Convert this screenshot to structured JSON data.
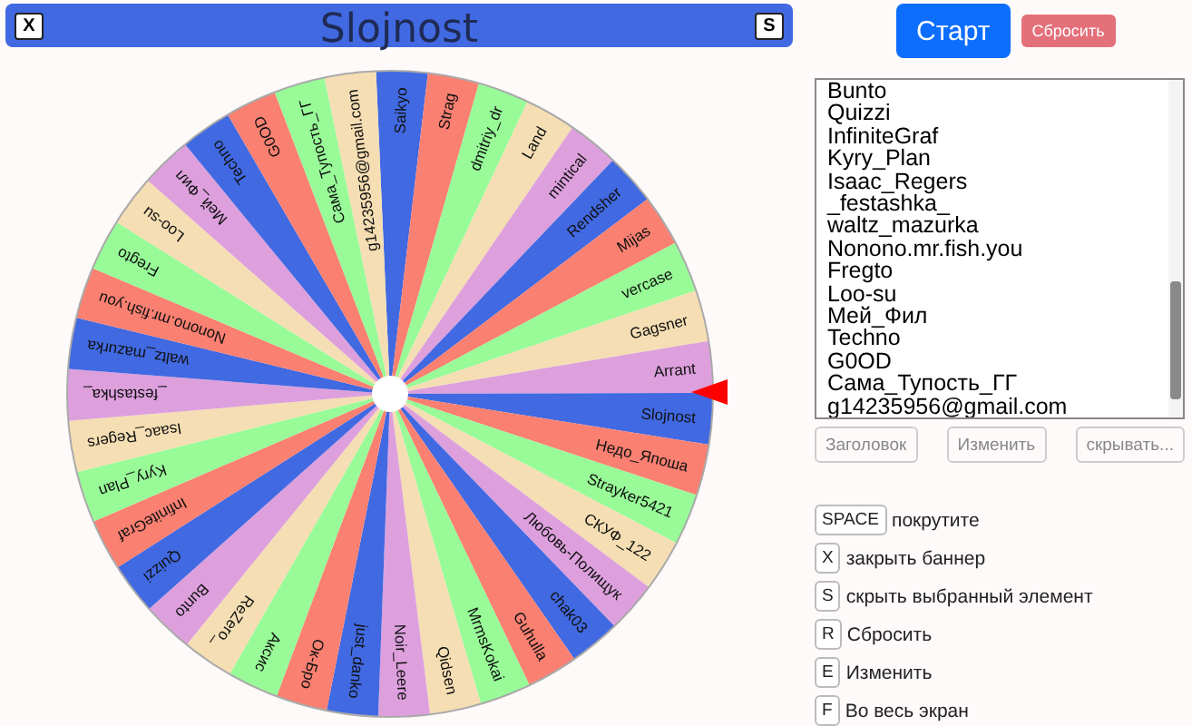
{
  "banner": {
    "title": "Slojnost",
    "close_key": "X",
    "hide_key": "S"
  },
  "wheel": {
    "segments": [
      {
        "label": "Saikyo"
      },
      {
        "label": "Strag"
      },
      {
        "label": "dmitriy_dr"
      },
      {
        "label": "Land"
      },
      {
        "label": "mintical"
      },
      {
        "label": "Rendsher"
      },
      {
        "label": "Mijas"
      },
      {
        "label": "vercase"
      },
      {
        "label": "Gagsner"
      },
      {
        "label": "Arrant"
      },
      {
        "label": "Slojnost"
      },
      {
        "label": "Недо_Япоша"
      },
      {
        "label": "Strayker5421"
      },
      {
        "label": "СКУФ_122"
      },
      {
        "label": "Любовь-Полищук"
      },
      {
        "label": "chak03"
      },
      {
        "label": "Guhulla"
      },
      {
        "label": "MrmsKokai"
      },
      {
        "label": "Qidsen"
      },
      {
        "label": "Noir_Leere"
      },
      {
        "label": "just_danko"
      },
      {
        "label": "Ок-Бро"
      },
      {
        "label": "Аксис"
      },
      {
        "label": "ReZero_"
      },
      {
        "label": "Bunto"
      },
      {
        "label": "Quizzi"
      },
      {
        "label": "InfiniteGraf"
      },
      {
        "label": "Kyry_Plan"
      },
      {
        "label": "Isaac_Regers"
      },
      {
        "label": "_festashka_"
      },
      {
        "label": "waltz_mazurka"
      },
      {
        "label": "Nonono.mr.fish.you"
      },
      {
        "label": "Fregto"
      },
      {
        "label": "Loo-su"
      },
      {
        "label": "Мей_Фил"
      },
      {
        "label": "Techno"
      },
      {
        "label": "G0OD"
      },
      {
        "label": "Сама_Тупость_ГГ"
      },
      {
        "label": "g14235956@gmail.com"
      }
    ]
  },
  "controls": {
    "start": "Старт",
    "reset": "Сбросить"
  },
  "entries": {
    "lines": [
      "Bunto",
      "Quizzi",
      "InfiniteGraf",
      "Kyry_Plan",
      "Isaac_Regers",
      "_festashka_",
      "waltz_mazurka",
      "Nonono.mr.fish.you",
      "Fregto",
      "Loo-su",
      "Мей_Фил",
      "Techno",
      "G0OD",
      "Сама_Тупость_ГГ",
      "g14235956@gmail.com"
    ]
  },
  "entry_buttons": [
    "Заголовок",
    "Изменить",
    "скрывать..."
  ],
  "shortcuts": [
    {
      "key": "SPACE",
      "action": "покрутите"
    },
    {
      "key": "X",
      "action": "закрыть баннер"
    },
    {
      "key": "S",
      "action": "скрыть выбранный элемент"
    },
    {
      "key": "R",
      "action": "Сбросить"
    },
    {
      "key": "E",
      "action": "Изменить"
    },
    {
      "key": "F",
      "action": "Во весь экран"
    }
  ]
}
